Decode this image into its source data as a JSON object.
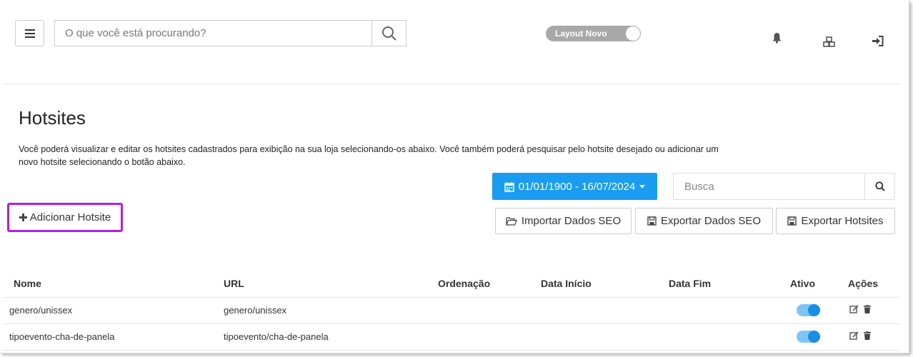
{
  "header": {
    "search_placeholder": "O que você está procurando?",
    "layout_toggle_label": "Layout Novo",
    "layout_toggle_on": true
  },
  "page": {
    "title": "Hotsites",
    "description": "Você poderá visualizar e editar os hotsites cadastrados para exibição na sua loja selecionando-os abaixo. Você também poderá pesquisar pelo hotsite desejado ou adicionar um novo hotsite selecionando o botão abaixo."
  },
  "toolbar": {
    "date_range": "01/01/1900 - 16/07/2024",
    "search_placeholder": "Busca",
    "add_label": "Adicionar Hotsite",
    "import_seo_label": "Importar Dados SEO",
    "export_seo_label": "Exportar Dados SEO",
    "export_hotsites_label": "Exportar Hotsites"
  },
  "table": {
    "columns": [
      "Nome",
      "URL",
      "Ordenação",
      "Data Início",
      "Data Fim",
      "Ativo",
      "Ações"
    ],
    "rows": [
      {
        "nome": "genero/unissex",
        "url": "genero/unissex",
        "ordenacao": "",
        "data_inicio": "",
        "data_fim": "",
        "ativo": true
      },
      {
        "nome": "tipoevento-cha-de-panela",
        "url": "tipoevento/cha-de-panela",
        "ordenacao": "",
        "data_inicio": "",
        "data_fim": "",
        "ativo": true
      }
    ]
  },
  "colors": {
    "primary": "#1a9cf0",
    "highlight": "#b41de6",
    "toggle_off": "#a8a8a8"
  }
}
